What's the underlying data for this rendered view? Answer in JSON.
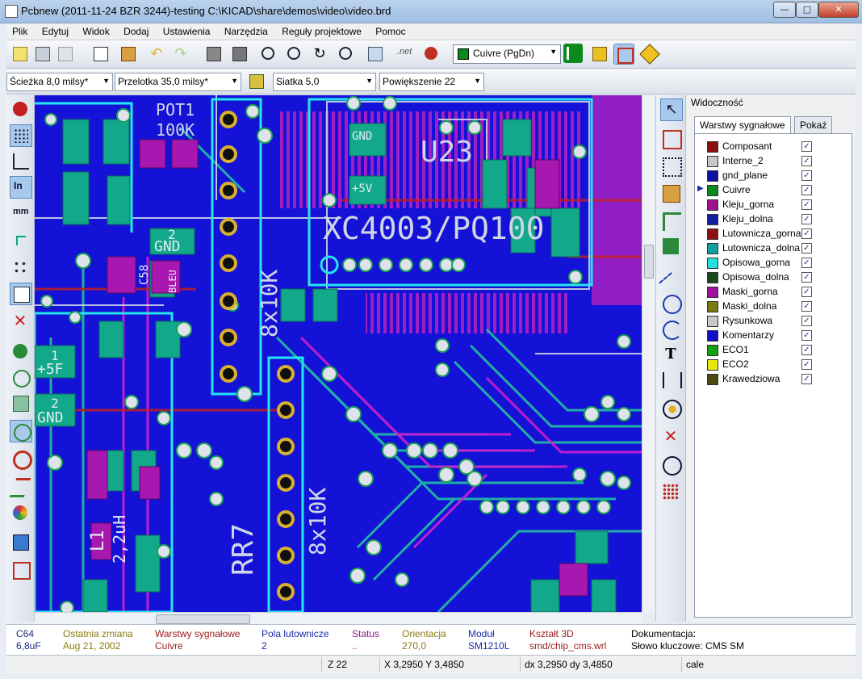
{
  "window": {
    "title": "Pcbnew (2011-11-24 BZR 3244)-testing C:\\KICAD\\share\\demos\\video\\video.brd"
  },
  "menu": [
    "Plik",
    "Edytuj",
    "Widok",
    "Dodaj",
    "Ustawienia",
    "Narzędzia",
    "Reguły projektowe",
    "Pomoc"
  ],
  "toolbar": {
    "layer_select": "Cuivre (PgDn)",
    "track_width": "Ścieżka 8,0 milsy*",
    "via_size": "Przelotka 35,0 milsy*",
    "grid": "Siatka 5,0",
    "zoom": "Powiększenie 22"
  },
  "canvas": {
    "labels": {
      "pot1": "POT1",
      "pot1_val": "100K",
      "u23": "U23",
      "xc": "XC4003/PQ100",
      "rr7": "RR7",
      "rr8_val": "8x10K",
      "rr7_val": "8x10K",
      "l1": "L1",
      "l1_val": "2,2uH",
      "gnd1": "GND",
      "gnd2": "GND",
      "gnd3": "GND",
      "p5v": "+5V",
      "p5f": "+5F",
      "n1": "1",
      "n2": "2",
      "n2b": "2",
      "bleu": "BLEU",
      "c58": "C58"
    }
  },
  "layers_panel": {
    "title": "Widoczność",
    "tab_signal": "Warstwy sygnałowe",
    "tab_show": "Pokaż",
    "check": "✓",
    "current_marker": "▶",
    "layers": [
      {
        "name": "Composant",
        "color": "#8b1010"
      },
      {
        "name": "Interne_2",
        "color": "#c8c8c8"
      },
      {
        "name": "gnd_plane",
        "color": "#1010a0"
      },
      {
        "name": "Cuivre",
        "color": "#0a8a1a"
      },
      {
        "name": "Kleju_gorna",
        "color": "#a01090"
      },
      {
        "name": "Kleju_dolna",
        "color": "#1020a0"
      },
      {
        "name": "Lutownicza_gorna",
        "color": "#8b1010"
      },
      {
        "name": "Lutownicza_dolna",
        "color": "#10a0a0"
      },
      {
        "name": "Opisowa_gorna",
        "color": "#20e0e0"
      },
      {
        "name": "Opisowa_dolna",
        "color": "#1a4a1a"
      },
      {
        "name": "Maski_gorna",
        "color": "#a010a0"
      },
      {
        "name": "Maski_dolna",
        "color": "#7a7a10"
      },
      {
        "name": "Rysunkowa",
        "color": "#c8c8c8"
      },
      {
        "name": "Komentarzy",
        "color": "#1010c8"
      },
      {
        "name": "ECO1",
        "color": "#10a010"
      },
      {
        "name": "ECO2",
        "color": "#e8e810"
      },
      {
        "name": "Krawedziowa",
        "color": "#4a4a10"
      }
    ]
  },
  "message_panel": {
    "ref": "C64",
    "value": "6,8uF",
    "last_change_label": "Ostatnia zmiana",
    "last_change": "Aug 21, 2002",
    "layer_label": "Warstwy sygnałowe",
    "layer": "Cuivre",
    "pads_label": "Pola lutownicze",
    "pads": "2",
    "status_label": "Status",
    "status": "..",
    "orient_label": "Orientacja",
    "orient": "270,0",
    "module_label": "Moduł",
    "module": "SM1210L",
    "shape3d_label": "Kształt 3D",
    "shape3d": "smd/chip_cms.wrl",
    "doc_label": "Dokumentacja:",
    "keywords": "Słowo kluczowe: CMS SM"
  },
  "status": {
    "zoom": "Z 22",
    "abs": "X 3,2950  Y 3,4850",
    "rel": "dx 3,2950  dy 3,4850",
    "units": "cale"
  }
}
